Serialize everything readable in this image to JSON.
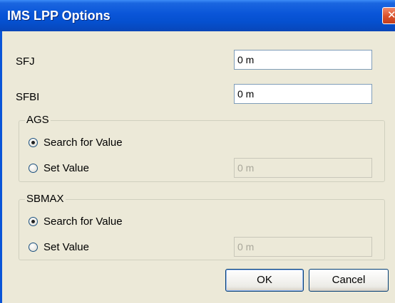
{
  "window": {
    "title": "IMS LPP Options",
    "close_glyph": "✕"
  },
  "fields": {
    "sfj": {
      "label": "SFJ",
      "value": "0 m"
    },
    "sfbi": {
      "label": "SFBI",
      "value": "0 m"
    }
  },
  "groups": {
    "ags": {
      "title": "AGS",
      "search_label": "Search for Value",
      "set_label": "Set Value",
      "selected": "search",
      "value": "0 m"
    },
    "sbmax": {
      "title": "SBMAX",
      "search_label": "Search for Value",
      "set_label": "Set Value",
      "selected": "search",
      "value": "0 m"
    }
  },
  "buttons": {
    "ok": "OK",
    "cancel": "Cancel"
  },
  "colors": {
    "titlebar": "#0a55d8",
    "dialog_bg": "#ece9d8",
    "close_button": "#d9502a"
  }
}
